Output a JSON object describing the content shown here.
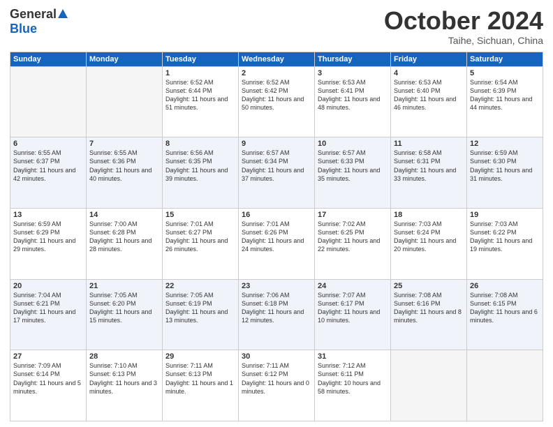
{
  "header": {
    "logo_general": "General",
    "logo_blue": "Blue",
    "title": "October 2024",
    "location": "Taihe, Sichuan, China"
  },
  "weekdays": [
    "Sunday",
    "Monday",
    "Tuesday",
    "Wednesday",
    "Thursday",
    "Friday",
    "Saturday"
  ],
  "weeks": [
    [
      {
        "day": "",
        "info": ""
      },
      {
        "day": "",
        "info": ""
      },
      {
        "day": "1",
        "info": "Sunrise: 6:52 AM\nSunset: 6:44 PM\nDaylight: 11 hours and 51 minutes."
      },
      {
        "day": "2",
        "info": "Sunrise: 6:52 AM\nSunset: 6:42 PM\nDaylight: 11 hours and 50 minutes."
      },
      {
        "day": "3",
        "info": "Sunrise: 6:53 AM\nSunset: 6:41 PM\nDaylight: 11 hours and 48 minutes."
      },
      {
        "day": "4",
        "info": "Sunrise: 6:53 AM\nSunset: 6:40 PM\nDaylight: 11 hours and 46 minutes."
      },
      {
        "day": "5",
        "info": "Sunrise: 6:54 AM\nSunset: 6:39 PM\nDaylight: 11 hours and 44 minutes."
      }
    ],
    [
      {
        "day": "6",
        "info": "Sunrise: 6:55 AM\nSunset: 6:37 PM\nDaylight: 11 hours and 42 minutes."
      },
      {
        "day": "7",
        "info": "Sunrise: 6:55 AM\nSunset: 6:36 PM\nDaylight: 11 hours and 40 minutes."
      },
      {
        "day": "8",
        "info": "Sunrise: 6:56 AM\nSunset: 6:35 PM\nDaylight: 11 hours and 39 minutes."
      },
      {
        "day": "9",
        "info": "Sunrise: 6:57 AM\nSunset: 6:34 PM\nDaylight: 11 hours and 37 minutes."
      },
      {
        "day": "10",
        "info": "Sunrise: 6:57 AM\nSunset: 6:33 PM\nDaylight: 11 hours and 35 minutes."
      },
      {
        "day": "11",
        "info": "Sunrise: 6:58 AM\nSunset: 6:31 PM\nDaylight: 11 hours and 33 minutes."
      },
      {
        "day": "12",
        "info": "Sunrise: 6:59 AM\nSunset: 6:30 PM\nDaylight: 11 hours and 31 minutes."
      }
    ],
    [
      {
        "day": "13",
        "info": "Sunrise: 6:59 AM\nSunset: 6:29 PM\nDaylight: 11 hours and 29 minutes."
      },
      {
        "day": "14",
        "info": "Sunrise: 7:00 AM\nSunset: 6:28 PM\nDaylight: 11 hours and 28 minutes."
      },
      {
        "day": "15",
        "info": "Sunrise: 7:01 AM\nSunset: 6:27 PM\nDaylight: 11 hours and 26 minutes."
      },
      {
        "day": "16",
        "info": "Sunrise: 7:01 AM\nSunset: 6:26 PM\nDaylight: 11 hours and 24 minutes."
      },
      {
        "day": "17",
        "info": "Sunrise: 7:02 AM\nSunset: 6:25 PM\nDaylight: 11 hours and 22 minutes."
      },
      {
        "day": "18",
        "info": "Sunrise: 7:03 AM\nSunset: 6:24 PM\nDaylight: 11 hours and 20 minutes."
      },
      {
        "day": "19",
        "info": "Sunrise: 7:03 AM\nSunset: 6:22 PM\nDaylight: 11 hours and 19 minutes."
      }
    ],
    [
      {
        "day": "20",
        "info": "Sunrise: 7:04 AM\nSunset: 6:21 PM\nDaylight: 11 hours and 17 minutes."
      },
      {
        "day": "21",
        "info": "Sunrise: 7:05 AM\nSunset: 6:20 PM\nDaylight: 11 hours and 15 minutes."
      },
      {
        "day": "22",
        "info": "Sunrise: 7:05 AM\nSunset: 6:19 PM\nDaylight: 11 hours and 13 minutes."
      },
      {
        "day": "23",
        "info": "Sunrise: 7:06 AM\nSunset: 6:18 PM\nDaylight: 11 hours and 12 minutes."
      },
      {
        "day": "24",
        "info": "Sunrise: 7:07 AM\nSunset: 6:17 PM\nDaylight: 11 hours and 10 minutes."
      },
      {
        "day": "25",
        "info": "Sunrise: 7:08 AM\nSunset: 6:16 PM\nDaylight: 11 hours and 8 minutes."
      },
      {
        "day": "26",
        "info": "Sunrise: 7:08 AM\nSunset: 6:15 PM\nDaylight: 11 hours and 6 minutes."
      }
    ],
    [
      {
        "day": "27",
        "info": "Sunrise: 7:09 AM\nSunset: 6:14 PM\nDaylight: 11 hours and 5 minutes."
      },
      {
        "day": "28",
        "info": "Sunrise: 7:10 AM\nSunset: 6:13 PM\nDaylight: 11 hours and 3 minutes."
      },
      {
        "day": "29",
        "info": "Sunrise: 7:11 AM\nSunset: 6:13 PM\nDaylight: 11 hours and 1 minute."
      },
      {
        "day": "30",
        "info": "Sunrise: 7:11 AM\nSunset: 6:12 PM\nDaylight: 11 hours and 0 minutes."
      },
      {
        "day": "31",
        "info": "Sunrise: 7:12 AM\nSunset: 6:11 PM\nDaylight: 10 hours and 58 minutes."
      },
      {
        "day": "",
        "info": ""
      },
      {
        "day": "",
        "info": ""
      }
    ]
  ]
}
